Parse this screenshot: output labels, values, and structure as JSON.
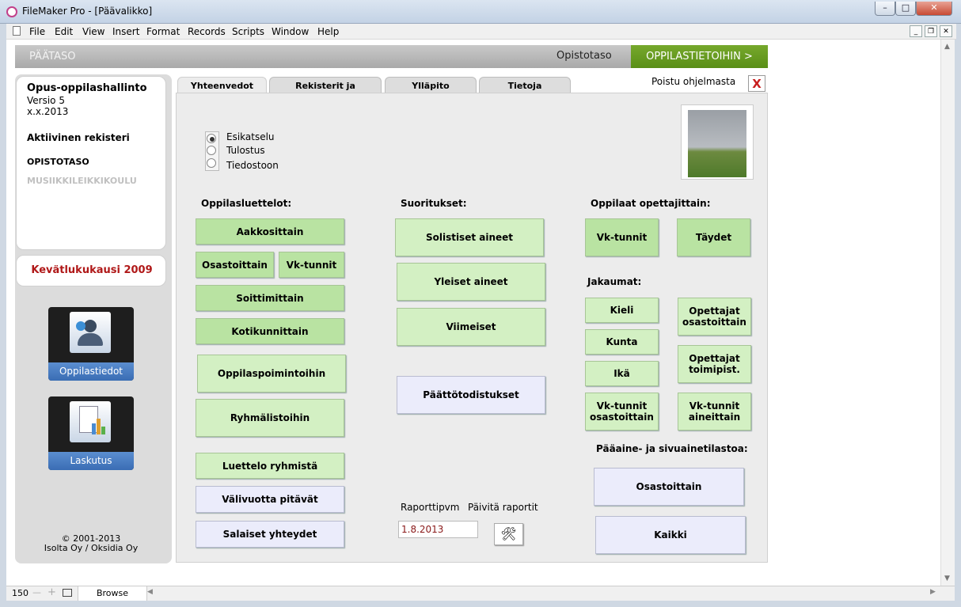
{
  "window": {
    "title": "FileMaker Pro - [Päävalikko]",
    "controls": [
      "–",
      "□",
      "✕"
    ]
  },
  "menu": [
    "File",
    "Edit",
    "View",
    "Insert",
    "Format",
    "Records",
    "Scripts",
    "Window",
    "Help"
  ],
  "header": {
    "left": "PÄÄTASO",
    "level": "Opistotaso",
    "next": "OPPILASTIETOIHIN >"
  },
  "left": {
    "app_name": "Opus-oppilashallinto",
    "version": "Versio 5",
    "date": "x.x.2013",
    "active_label": "Aktiivinen rekisteri",
    "registers": [
      "OPISTOTASO",
      "MUSIIKKILEIKKIKOULU"
    ],
    "term": "Kevätlukukausi 2009",
    "nav": [
      "Oppilastiedot",
      "Laskutus"
    ],
    "copyright": "© 2001-2013",
    "company": "Isolta Oy / Oksidia Oy"
  },
  "tabs": [
    "Yhteenvedot",
    "Rekisterit ja asetukset",
    "Ylläpito",
    "Tietoja"
  ],
  "exit": {
    "label": "Poistu ohjelmasta",
    "icon": "X"
  },
  "output": {
    "options": [
      "Esikatselu",
      "Tulostus",
      "Tiedostoon"
    ],
    "selected": 0
  },
  "oppilasluettelot": {
    "title": "Oppilasluettelot:",
    "aakkosittain": "Aakkosittain",
    "osastoittain": "Osastoittain",
    "vktunnit": "Vk-tunnit",
    "soittimittain": "Soittimittain",
    "kotikunnittain": "Kotikunnittain",
    "spoiminto": "Oppilaspoimintoihin",
    "ryhma": "Ryhmälistoihin",
    "luettelo": "Luettelo ryhmistä",
    "valivuotta": "Välivuotta pitävät",
    "salaiset": "Salaiset yhteydet"
  },
  "suoritukset": {
    "title": "Suoritukset:",
    "solistiset": "Solistiset aineet",
    "yleiset": "Yleiset aineet",
    "viimeiset": "Viimeiset",
    "paattotodistukset": "Päättötodistukset"
  },
  "report": {
    "date_label": "Raporttipvm",
    "update_label": "Päivitä raportit",
    "date_value": "1.8.2013"
  },
  "opettajittain": {
    "title": "Oppilaat opettajittain:",
    "vktunnit": "Vk-tunnit",
    "taydet": "Täydet"
  },
  "jakaumat": {
    "title": "Jakaumat:",
    "kieli": "Kieli",
    "kunta": "Kunta",
    "ika": "Ikä",
    "vk_osast": [
      "Vk-tunnit",
      "osastoittain"
    ],
    "opettajat_osast": [
      "Opettajat",
      "osastoittain"
    ],
    "opettajat_toim": [
      "Opettajat",
      "toimipist."
    ],
    "vk_aine": [
      "Vk-tunnit",
      "aineittain"
    ]
  },
  "tilastoa": {
    "title": "Pääaine- ja sivuainetilastoa:",
    "osastoittain": "Osastoittain",
    "kaikki": "Kaikki"
  },
  "status": {
    "zoom": "150",
    "mode": "Browse"
  }
}
